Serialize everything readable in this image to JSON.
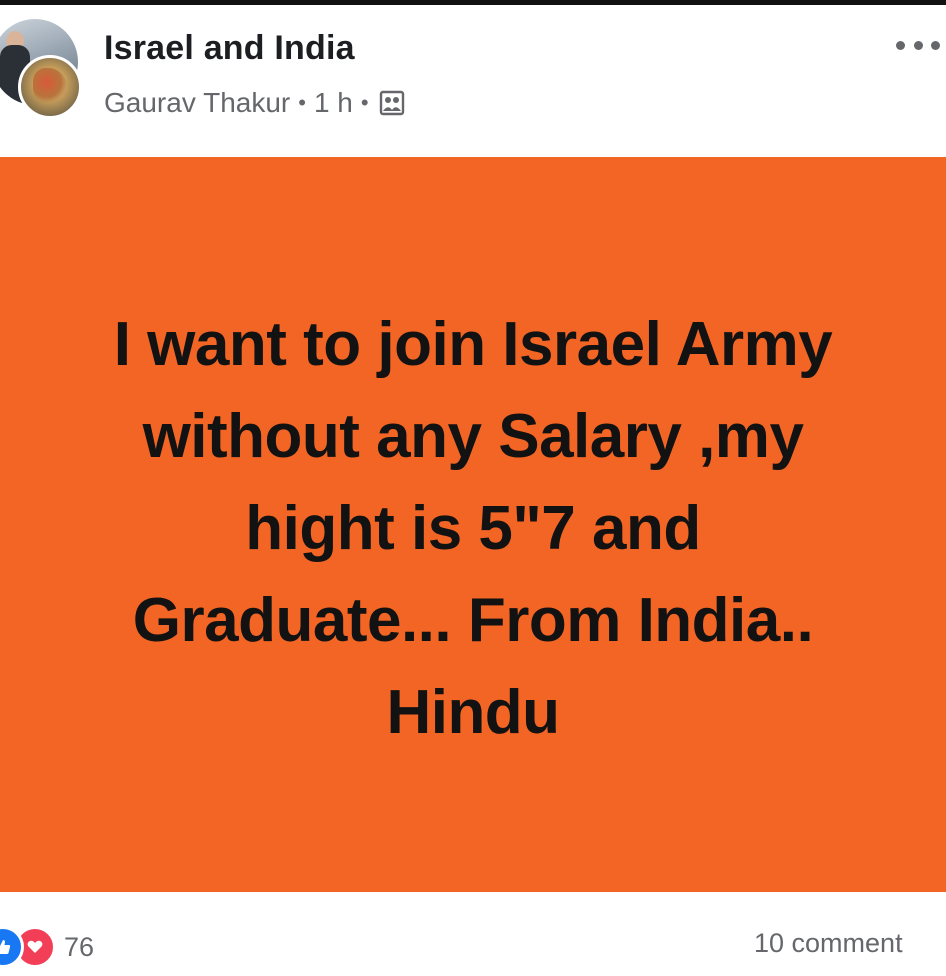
{
  "post": {
    "page_name": "Israel and India",
    "author": "Gaurav Thakur",
    "separator": "•",
    "time": "1 h",
    "privacy_icon": "group-icon",
    "more_icon": "more-horizontal-icon",
    "body_lines": [
      "I want to join Israel Army",
      "without any Salary ,my",
      "hight is 5\"7 and",
      "Graduate... From India..",
      "Hindu"
    ],
    "background_color": "#f26524",
    "text_color": "#121212"
  },
  "footer": {
    "reaction_icons": [
      "like-icon",
      "love-icon"
    ],
    "reaction_count": "76",
    "comments": "10 comment"
  }
}
